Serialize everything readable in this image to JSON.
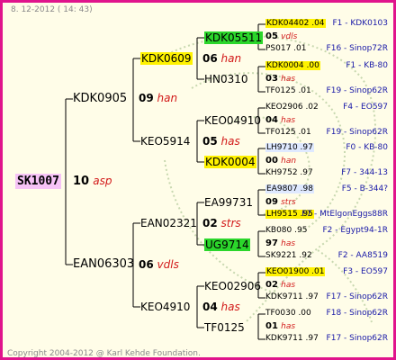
{
  "header": {
    "date": "8. 12-2012 ( 14: 43)"
  },
  "footer": {
    "copyright": "Copyright 2004-2012 @ Karl Kehde Foundation."
  },
  "root": {
    "name": "SK1007",
    "gen": "10",
    "note": "asp"
  },
  "gen1": [
    {
      "name": "KDK0905",
      "gen": "09",
      "note": "han"
    },
    {
      "name": "EAN06303",
      "gen": "06",
      "note": "vdls"
    }
  ],
  "gen2": [
    {
      "name": "KDK0609",
      "gen": "06",
      "note": "han"
    },
    {
      "name": "KEO5914",
      "gen": "05",
      "note": "has"
    },
    {
      "name": "EAN02321",
      "gen": "02",
      "note": "strs"
    },
    {
      "name": "KEO4910",
      "gen": "04",
      "note": "has"
    }
  ],
  "gen3": [
    {
      "name": "KDK05511"
    },
    {
      "name": "HN0310"
    },
    {
      "name": "KEO04910"
    },
    {
      "name": "KDK0004"
    },
    {
      "name": "EA99731"
    },
    {
      "name": "UG9714"
    },
    {
      "name": "KEO02906"
    },
    {
      "name": "TF0125"
    }
  ],
  "gen4": [
    {
      "name": "KDK04402 .04",
      "mid": "05",
      "mid_note": "vdls",
      "bottom": "PS017 .01",
      "id_top": "F1 - KDK0103",
      "id_bottom": "F16 - Sinop72R"
    },
    {
      "name": "KDK0004 .00",
      "mid": "03",
      "mid_note": "has",
      "bottom": "TF0125 .01",
      "id_top": "F1 - KB-80",
      "id_bottom": "F19 - Sinop62R"
    },
    {
      "name": "KEO2906 .02",
      "mid": "04",
      "mid_note": "has",
      "bottom": "TF0125 .01",
      "id_top": "F4 - EO597",
      "id_bottom": "F19 - Sinop62R"
    },
    {
      "name": "LH9710 .97",
      "mid": "00",
      "mid_note": "han",
      "bottom": "KH9752 .97",
      "id_top": "F0 - KB-80",
      "id_bottom": "F7 - 344-13"
    },
    {
      "name": "EA9807 .98",
      "mid": "09",
      "mid_note": "strs",
      "bottom": "LH9515 .95",
      "id_top": "F5 - B-344?",
      "id_bottom": "F7 - MtElgonEggs88R"
    },
    {
      "name": "KB080 .95",
      "mid": "97",
      "mid_note": "has",
      "bottom": "SK9221 .92",
      "id_top": "F2 - Egypt94-1R",
      "id_bottom": "F2 - AA8519"
    },
    {
      "name": "KEO01900 .01",
      "mid": "02",
      "mid_note": "has",
      "bottom": "KDK9711 .97",
      "id_top": "F3 - EO597",
      "id_bottom": "F17 - Sinop62R"
    },
    {
      "name": "TF0030 .00",
      "mid": "01",
      "mid_note": "has",
      "bottom": "KDK9711 .97",
      "id_top": "F18 - Sinop62R",
      "id_bottom": "F17 - Sinop62R"
    }
  ]
}
